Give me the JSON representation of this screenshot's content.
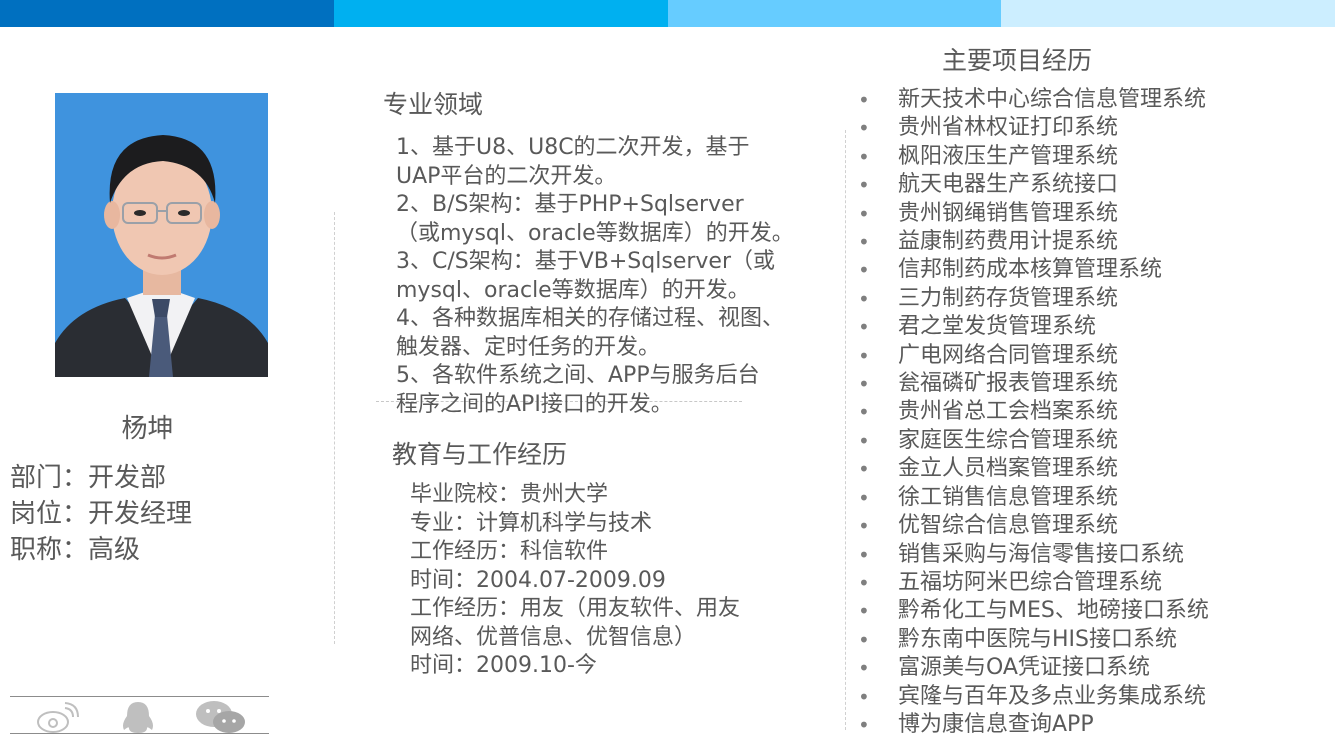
{
  "colors": {
    "band": [
      "#0070c0",
      "#00b0f0",
      "#66ccff",
      "#cceeff"
    ],
    "text": "#595959",
    "photo_bg": "#3f93de"
  },
  "profile": {
    "name": "杨坤",
    "department": "部门：开发部",
    "position": "岗位：开发经理",
    "title": "职称：高级"
  },
  "specialty": {
    "heading": "专业领域",
    "lines": [
      "1、基于U8、U8C的二次开发，基于",
      "UAP平台的二次开发。",
      "2、B/S架构：基于PHP+Sqlserver",
      "（或mysql、oracle等数据库）的开发。",
      "3、C/S架构：基于VB+Sqlserver（或",
      "mysql、oracle等数据库）的开发。",
      "4、各种数据库相关的存储过程、视图、",
      "触发器、定时任务的开发。",
      "5、各软件系统之间、APP与服务后台",
      "程序之间的API接口的开发。"
    ]
  },
  "education": {
    "heading": "教育与工作经历",
    "lines": [
      "毕业院校：贵州大学",
      "专业：计算机科学与技术",
      "工作经历：科信软件",
      "时间：2004.07-2009.09",
      "工作经历：用友（用友软件、用友",
      "网络、优普信息、优智信息）",
      "时间：2009.10-今"
    ]
  },
  "projects": {
    "heading": "主要项目经历",
    "items": [
      "新天技术中心综合信息管理系统",
      "贵州省林权证打印系统",
      "枫阳液压生产管理系统",
      "航天电器生产系统接口",
      "贵州钢绳销售管理系统",
      "益康制药费用计提系统",
      "信邦制药成本核算管理系统",
      "三力制药存货管理系统",
      "君之堂发货管理系统",
      "广电网络合同管理系统",
      "瓮福磷矿报表管理系统",
      "贵州省总工会档案系统",
      "家庭医生综合管理系统",
      "金立人员档案管理系统",
      "徐工销售信息管理系统",
      "优智综合信息管理系统",
      "销售采购与海信零售接口系统",
      "五福坊阿米巴综合管理系统",
      "黔希化工与MES、地磅接口系统",
      "黔东南中医院与HIS接口系统",
      "富源美与OA凭证接口系统",
      "宾隆与百年及多点业务集成系统",
      "博为康信息查询APP"
    ]
  },
  "social_icons": [
    "weibo-icon",
    "qq-icon",
    "wechat-icon"
  ]
}
